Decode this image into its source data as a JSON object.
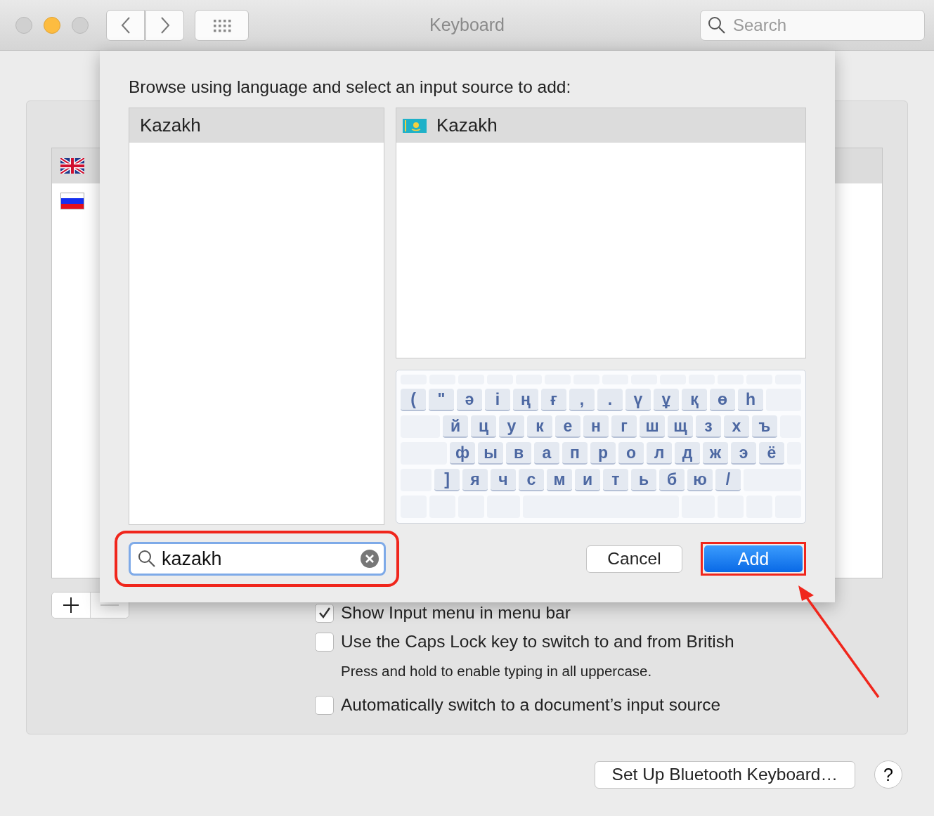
{
  "window": {
    "title": "Keyboard",
    "search": {
      "placeholder": "Search"
    }
  },
  "background": {
    "input_sources": [
      {
        "selected": true
      },
      {
        "selected": false
      }
    ],
    "checkboxes": [
      {
        "label": "Show Input menu in menu bar",
        "checked": true
      },
      {
        "label": "Use the Caps Lock key to switch to and from British",
        "checked": false,
        "note": "Press and hold to enable typing in all uppercase."
      },
      {
        "label": "Automatically switch to a document’s input source",
        "checked": false
      }
    ],
    "bluetooth_button": "Set Up Bluetooth Keyboard…",
    "help_button": "?"
  },
  "sheet": {
    "prompt": "Browse using language and select an input source to add:",
    "languages": [
      {
        "label": "Kazakh",
        "selected": true
      }
    ],
    "sources": [
      {
        "label": "Kazakh",
        "selected": true
      }
    ],
    "keyboard_rows": [
      [
        "(",
        "\"",
        "ә",
        "і",
        "ң",
        "ғ",
        ",",
        ".",
        "ү",
        "ұ",
        "қ",
        "ө",
        "һ"
      ],
      [
        "й",
        "ц",
        "у",
        "к",
        "е",
        "н",
        "г",
        "ш",
        "щ",
        "з",
        "х",
        "ъ"
      ],
      [
        "ф",
        "ы",
        "в",
        "а",
        "п",
        "р",
        "о",
        "л",
        "д",
        "ж",
        "э",
        "ё"
      ],
      [
        "]",
        "я",
        "ч",
        "с",
        "м",
        "и",
        "т",
        "ь",
        "б",
        "ю",
        "/"
      ]
    ],
    "search": {
      "value": "kazakh"
    },
    "buttons": [
      {
        "label": "Cancel",
        "kind": "secondary"
      },
      {
        "label": "Add",
        "kind": "default"
      }
    ]
  }
}
